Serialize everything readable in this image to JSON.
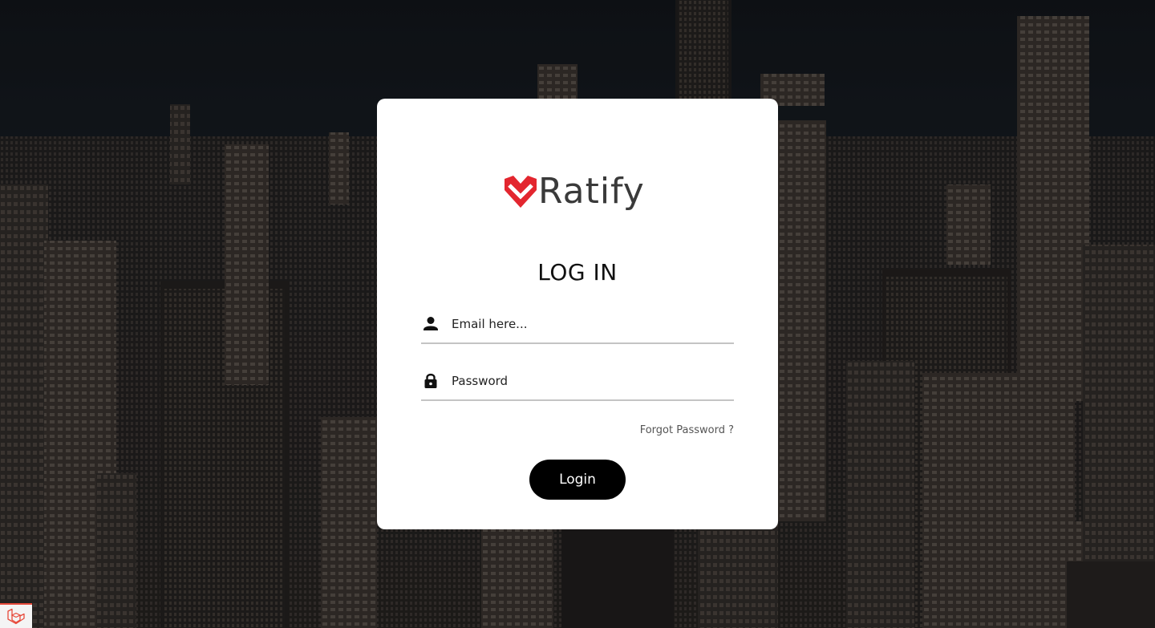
{
  "brand": {
    "name": "Ratify",
    "logo_icon": "ratify-heart-check-logo",
    "logo_color": "#e3262f",
    "text_color": "#3a3a3a"
  },
  "page": {
    "title": "LOG IN",
    "background": "city-skyline-photo"
  },
  "form": {
    "email": {
      "icon": "user-icon",
      "placeholder": "Email here...",
      "value": ""
    },
    "password": {
      "icon": "lock-icon",
      "placeholder": "Password",
      "value": ""
    },
    "forgot_label": "Forgot Password ?",
    "submit_label": "Login"
  },
  "debug_badge": {
    "icon": "laravel-icon",
    "color": "#e74a3b"
  }
}
